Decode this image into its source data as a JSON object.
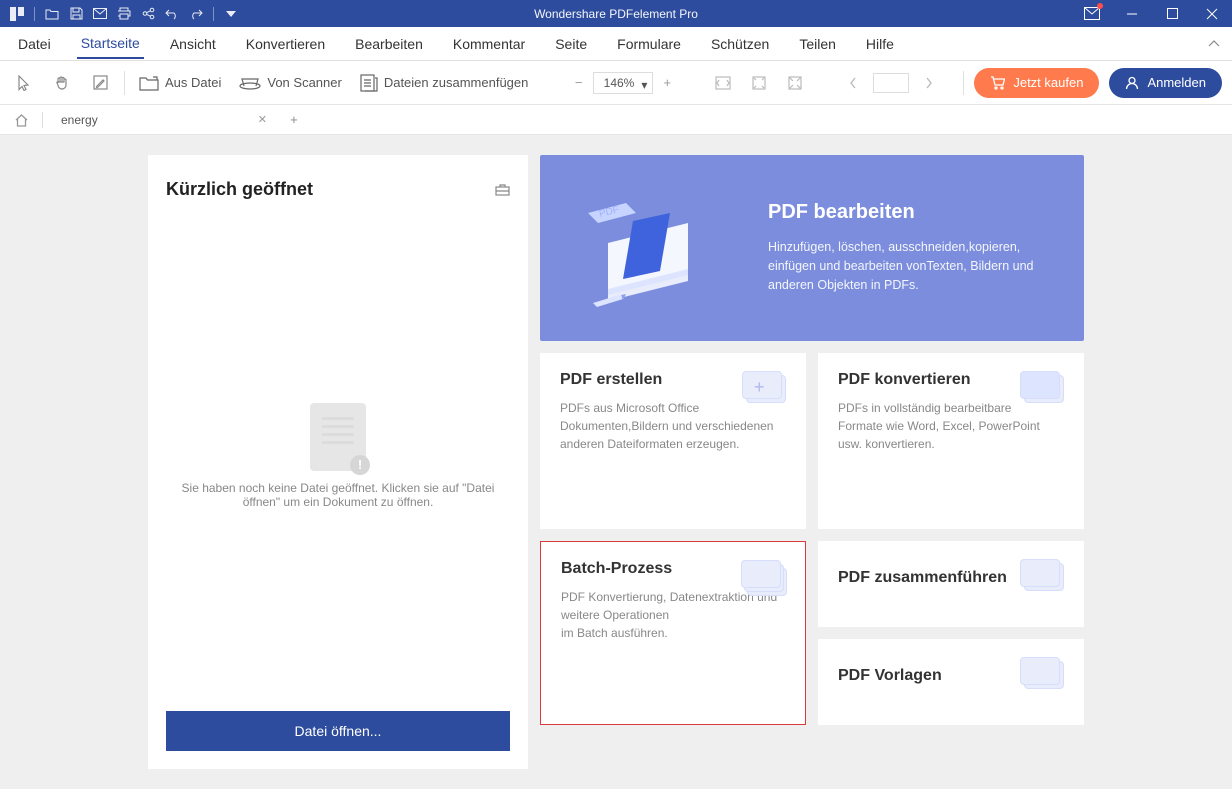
{
  "app_title": "Wondershare PDFelement Pro",
  "menu": [
    "Datei",
    "Startseite",
    "Ansicht",
    "Konvertieren",
    "Bearbeiten",
    "Kommentar",
    "Seite",
    "Formulare",
    "Schützen",
    "Teilen",
    "Hilfe"
  ],
  "menu_active_index": 1,
  "toolbar": {
    "from_file": "Aus Datei",
    "from_scanner": "Von  Scanner",
    "merge": "Dateien zusammenfügen",
    "zoom_value": "146%",
    "buy_label": "Jetzt kaufen",
    "login_label": "Anmelden"
  },
  "tabs": {
    "items": [
      {
        "name": "energy"
      }
    ]
  },
  "recent": {
    "title": "Kürzlich geöffnet",
    "empty_text": "Sie haben noch keine Datei geöffnet. Klicken sie auf \"Datei öffnen\" um ein Dokument zu öffnen.",
    "open_button": "Datei öffnen..."
  },
  "hero": {
    "title": "PDF bearbeiten",
    "desc": "Hinzufügen, löschen, ausschneiden,kopieren, einfügen und bearbeiten vonTexten, Bildern und anderen Objekten in PDFs."
  },
  "cards": [
    {
      "key": "create",
      "title": "PDF erstellen",
      "desc": "PDFs aus Microsoft Office Dokumenten,Bildern und verschiedenen anderen Dateiformaten erzeugen."
    },
    {
      "key": "convert",
      "title": "PDF konvertieren",
      "desc": "PDFs in vollständig bearbeitbare Formate wie Word, Excel, PowerPoint usw. konvertieren."
    },
    {
      "key": "batch",
      "title": "Batch-Prozess",
      "desc": "PDF Konvertierung, Datenextraktion und weitere Operationen\nim Batch ausführen.",
      "selected": true
    },
    {
      "key": "merge",
      "title": "PDF zusammenführen",
      "desc": ""
    },
    {
      "key": "templates",
      "title": "PDF Vorlagen",
      "desc": ""
    }
  ]
}
